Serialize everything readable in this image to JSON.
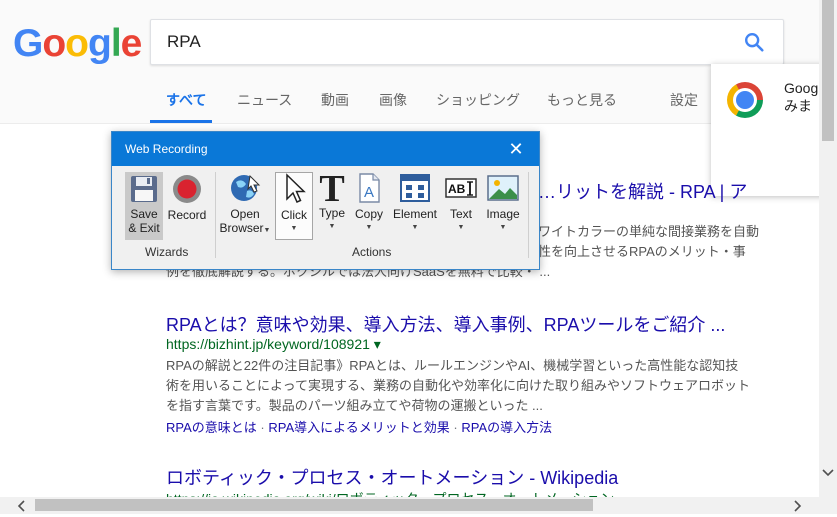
{
  "search": {
    "query": "RPA"
  },
  "logo": {
    "text": "Google"
  },
  "tabs": [
    {
      "label": "すべて"
    },
    {
      "label": "ニュース"
    },
    {
      "label": "動画"
    },
    {
      "label": "画像"
    },
    {
      "label": "ショッピング"
    },
    {
      "label": "もっと見る"
    }
  ],
  "settings": {
    "label": "設定"
  },
  "chrome_popup": {
    "line1": "Goog",
    "line2": "みま"
  },
  "results": [
    {
      "title": "…リットを解説 - RPA | ア",
      "snippet1": "ワイトカラーの単純な間接業務を自動",
      "snippet2": "性を向上させるRPAのメリット・事",
      "snippet3": "例を徹底解説する。ボクシルでは法人向けSaaSを無料で比較・ ..."
    },
    {
      "title": "RPAとは？意味や効果、導入方法、導入事例、RPAツールをご紹介 ...",
      "url": "https://bizhint.jp/keyword/108921",
      "url_arrow": "▾",
      "snippet1": "RPAの解説と22件の注目記事》RPAとは、ルールエンジンやAI、機械学習といった高性能な認知技",
      "snippet2": "術を用いることによって実現する、業務の自動化や効率化に向けた取り組みやソフトウェアロボット",
      "snippet3": "を指す言葉です。製品のパーツ組み立てや荷物の運搬といった ...",
      "sitelinks": [
        "RPAの意味とは",
        "RPA導入によるメリットと効果",
        "RPAの導入方法"
      ],
      "sitelink_sep": "·"
    },
    {
      "title": "ロボティック・プロセス・オートメーション - Wikipedia",
      "url": "https://ja.wikipedia.org/wiki/ロボティック・プロセス・オートメーション"
    }
  ],
  "dialog": {
    "title": "Web Recording",
    "close": "✕",
    "wizards_label": "Wizards",
    "actions_label": "Actions",
    "tools": {
      "save_exit": [
        "Save",
        "& Exit"
      ],
      "record": "Record",
      "open_browser": [
        "Open",
        "Browser"
      ],
      "click": "Click",
      "type": "Type",
      "copy": "Copy",
      "element": "Element",
      "text": "Text",
      "image": "Image"
    },
    "dropdown_glyph": "▼"
  },
  "colors": {
    "accent": "#1a73e8",
    "link": "#1a0dab",
    "url": "#006621",
    "dialog_title": "#0a78d7",
    "record": "#d9232f"
  },
  "icons": [
    "search-icon",
    "chrome-icon",
    "close-icon",
    "floppy-icon",
    "record-icon",
    "globe-icon",
    "cursor-icon",
    "type-icon",
    "copy-icon",
    "element-icon",
    "text-icon",
    "image-icon",
    "chevron-left-icon",
    "chevron-right-icon",
    "chevron-down-icon"
  ]
}
